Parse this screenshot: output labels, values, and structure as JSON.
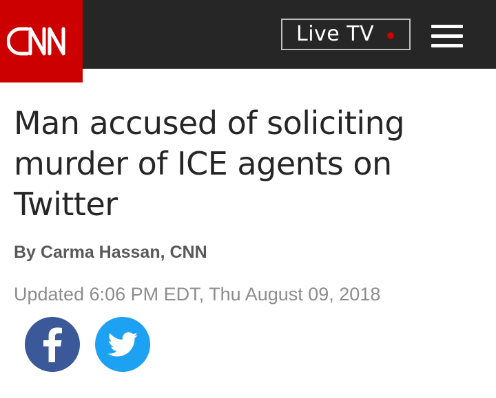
{
  "header": {
    "logo_text": "CNN",
    "live_tv_label": "Live TV",
    "colors": {
      "bar": "#262626",
      "brand_red": "#cc0000",
      "live_dot": "#cc0000"
    },
    "menu_icon": "hamburger-menu-icon"
  },
  "article": {
    "headline": "Man accused of soliciting murder of ICE agents on Twitter",
    "byline": "By Carma Hassan, CNN",
    "updated": "Updated 6:06 PM EDT, Thu August 09, 2018"
  },
  "share": {
    "facebook": {
      "icon": "facebook-icon",
      "color": "#3b5998"
    },
    "twitter": {
      "icon": "twitter-bird-icon",
      "color": "#1da1f2"
    }
  }
}
